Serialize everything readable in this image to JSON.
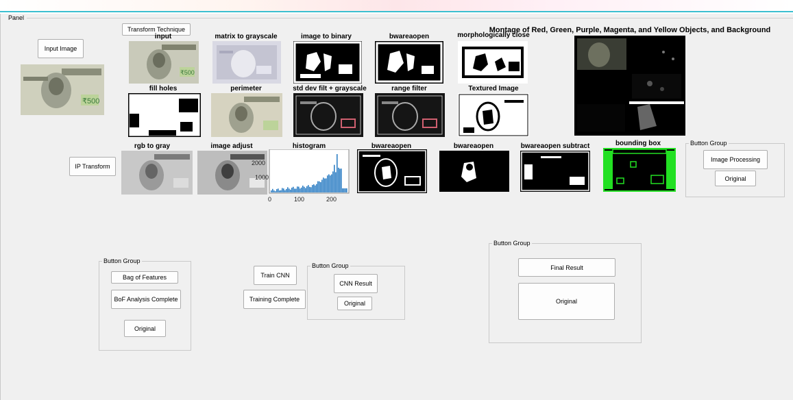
{
  "panel": {
    "title": "Panel"
  },
  "buttons": {
    "input_image": "Input Image",
    "transform_technique": "Transform Technique",
    "ip_transform": "IP Transform",
    "bag_of_features": "Bag of Features",
    "bof_complete": "BoF Analysis Complete",
    "bof_original": "Original",
    "train_cnn": "Train CNN",
    "training_complete": "Training Complete",
    "cnn_result": "CNN Result",
    "cnn_original": "Original",
    "final_result": "Final Result",
    "final_original": "Original",
    "image_processing": "Image Processing",
    "ip_original": "Original"
  },
  "groups": {
    "ip_group": "Button Group",
    "bof_group": "Button Group",
    "cnn_group": "Button Group",
    "final_group": "Button Group"
  },
  "titles": {
    "input": "input",
    "matrix_to_grayscale": "matrix to grayscale",
    "image_to_binary": "image to binary",
    "bwareaopen_1": "bwareaopen",
    "morph_close": "morphologically close",
    "montage": "Montage of Red, Green, Purple, Magenta, and Yellow Objects, and Background",
    "fill_holes": "fill holes",
    "perimeter": "perimeter",
    "std_dev": "std dev filt + grayscale",
    "range_filter": "range filter",
    "textured": "Textured Image",
    "rgb_to_gray": "rgb to gray",
    "image_adjust": "image adjust",
    "histogram": "histogram",
    "bwareaopen_2": "bwareaopen",
    "bwareaopen_3": "bwareaopen",
    "bwareaopen_subtract": "bwareaopen subtract",
    "bounding_box": "bounding box"
  },
  "histogram_axis": {
    "y_ticks": [
      "2000",
      "1000"
    ],
    "x_ticks": [
      "0",
      "100",
      "200"
    ]
  },
  "colors": {
    "panel_bg": "#f0f0f0",
    "accent_line": "#3bbfd0",
    "histogram_bar": "#2f7fc4",
    "bbox_green": "#22e022"
  }
}
